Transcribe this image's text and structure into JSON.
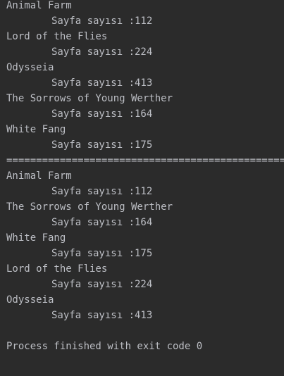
{
  "console": {
    "first_list": [
      {
        "title": "Animal Farm",
        "pages": "Sayfa sayısı :112"
      },
      {
        "title": "Lord of the Flies",
        "pages": "Sayfa sayısı :224"
      },
      {
        "title": "Odysseia",
        "pages": "Sayfa sayısı :413"
      },
      {
        "title": "The Sorrows of Young Werther",
        "pages": "Sayfa sayısı :164"
      },
      {
        "title": "White Fang",
        "pages": "Sayfa sayısı :175"
      }
    ],
    "separator": "===============================================",
    "second_list": [
      {
        "title": "Animal Farm",
        "pages": "Sayfa sayısı :112"
      },
      {
        "title": "The Sorrows of Young Werther",
        "pages": "Sayfa sayısı :164"
      },
      {
        "title": "White Fang",
        "pages": "Sayfa sayısı :175"
      },
      {
        "title": "Lord of the Flies",
        "pages": "Sayfa sayısı :224"
      },
      {
        "title": "Odysseia",
        "pages": "Sayfa sayısı :413"
      }
    ],
    "exit_message": "Process finished with exit code 0"
  }
}
